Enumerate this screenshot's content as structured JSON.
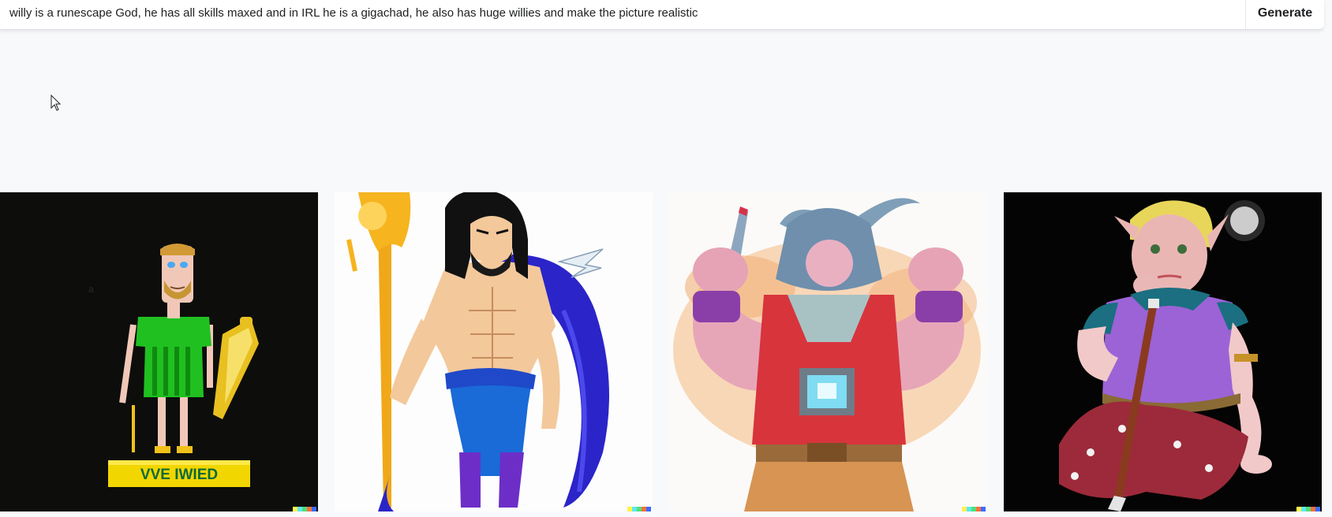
{
  "prompt": {
    "value": "willy is a runescape God, he has all skills maxed and in IRL he is a gigachad, he also has huge willies and make the picture realistic",
    "generate_label": "Generate"
  },
  "results": [
    {
      "plaque_text": "VVE IWIED",
      "style": "dark background, green tunic statue figure"
    },
    {
      "style": "white background, muscular warrior with staff"
    },
    {
      "style": "watercolor, hooded muscular figure"
    },
    {
      "style": "dark background, elf sitting"
    }
  ],
  "colors": {
    "accent_watermark": [
      "#fff34d",
      "#5ee8f0",
      "#4ce07a",
      "#ff6e3a",
      "#3a6bff"
    ]
  }
}
